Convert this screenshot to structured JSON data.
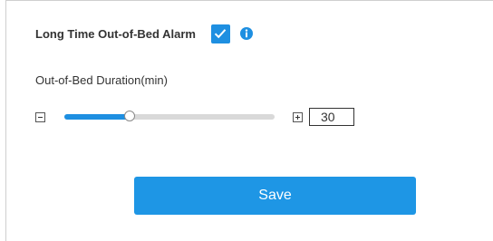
{
  "alarm": {
    "title": "Long Time Out-of-Bed Alarm",
    "enabled": true,
    "info_icon": "info-icon",
    "checkbox_icon": "check-icon"
  },
  "duration": {
    "label": "Out-of-Bed Duration(min)",
    "value": "30",
    "slider_fraction": 0.31,
    "minus_icon": "minus-box-icon",
    "plus_icon": "plus-box-icon"
  },
  "actions": {
    "save_label": "Save"
  },
  "colors": {
    "accent": "#1e8fe1",
    "button": "#1e96e5",
    "track": "#d9d9d9"
  }
}
